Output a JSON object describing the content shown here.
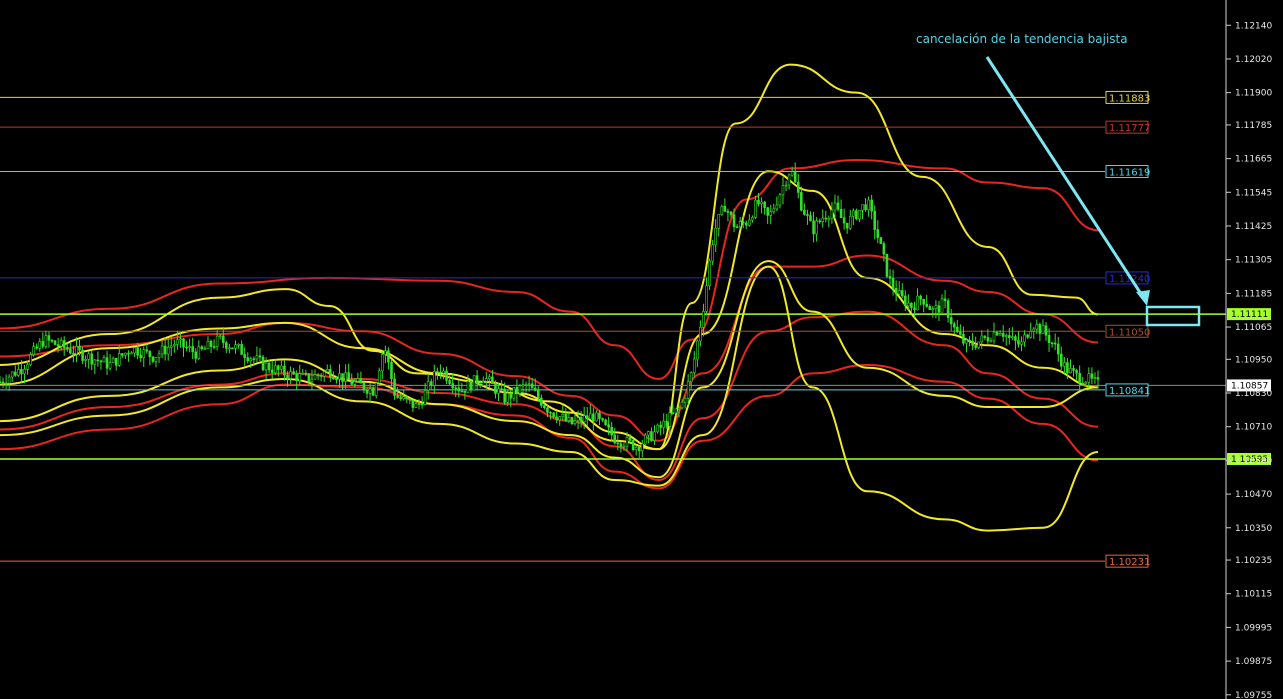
{
  "chart_data": {
    "type": "candlestick",
    "annotation": "cancelación de la tendencia bajista",
    "y_range": [
      1.0974,
      1.1223
    ],
    "y_ticks": [
      "1.12140",
      "1.12020",
      "1.11900",
      "1.11785",
      "1.11665",
      "1.11545",
      "1.11425",
      "1.11305",
      "1.11185",
      "1.11065",
      "1.10950",
      "1.10830",
      "1.10710",
      "1.10590",
      "1.10470",
      "1.10350",
      "1.10235",
      "1.10115",
      "1.09995",
      "1.09875",
      "1.09755"
    ],
    "levels": [
      {
        "value": 1.11883,
        "label": "1.11883",
        "color": "#e6d34a"
      },
      {
        "value": 1.11777,
        "label": "1.11777",
        "color": "#c0392b"
      },
      {
        "value": 1.11619,
        "label": "1.11619",
        "color": "#4fd6e6"
      },
      {
        "value": 1.1124,
        "label": "1.11240",
        "color": "#2a2ad0"
      },
      {
        "value": 1.11111,
        "label": "1.11111",
        "color": "#a6ff2e",
        "filled": true
      },
      {
        "value": 1.1105,
        "label": "1.11050",
        "color": "#a0522d"
      },
      {
        "value": 1.10841,
        "label": "1.10841",
        "color": "#4fd6e6"
      },
      {
        "value": 1.10595,
        "label": "1.10595",
        "color": "#a6ff2e",
        "filled": true
      },
      {
        "value": 1.10231,
        "label": "1.10231",
        "color": "#e0663a"
      }
    ],
    "current_price": {
      "value": 1.10857,
      "label": "1.10857"
    },
    "price_path": [
      [
        0.0,
        1.1087
      ],
      [
        0.02,
        1.1092
      ],
      [
        0.04,
        1.1102
      ],
      [
        0.06,
        1.1099
      ],
      [
        0.08,
        1.1096
      ],
      [
        0.1,
        1.1093
      ],
      [
        0.12,
        1.1099
      ],
      [
        0.14,
        1.1096
      ],
      [
        0.16,
        1.1101
      ],
      [
        0.18,
        1.1097
      ],
      [
        0.2,
        1.1102
      ],
      [
        0.22,
        1.1098
      ],
      [
        0.24,
        1.1093
      ],
      [
        0.26,
        1.109
      ],
      [
        0.28,
        1.1088
      ],
      [
        0.3,
        1.1091
      ],
      [
        0.32,
        1.1087
      ],
      [
        0.34,
        1.1084
      ],
      [
        0.35,
        1.11
      ],
      [
        0.36,
        1.1082
      ],
      [
        0.38,
        1.1078
      ],
      [
        0.4,
        1.1092
      ],
      [
        0.42,
        1.1084
      ],
      [
        0.44,
        1.1089
      ],
      [
        0.46,
        1.1081
      ],
      [
        0.48,
        1.1086
      ],
      [
        0.5,
        1.1077
      ],
      [
        0.52,
        1.1072
      ],
      [
        0.54,
        1.1075
      ],
      [
        0.56,
        1.1067
      ],
      [
        0.58,
        1.1064
      ],
      [
        0.6,
        1.107
      ],
      [
        0.62,
        1.1078
      ],
      [
        0.63,
        1.109
      ],
      [
        0.64,
        1.1112
      ],
      [
        0.65,
        1.114
      ],
      [
        0.66,
        1.115
      ],
      [
        0.67,
        1.1142
      ],
      [
        0.68,
        1.1144
      ],
      [
        0.69,
        1.1151
      ],
      [
        0.7,
        1.1145
      ],
      [
        0.71,
        1.1154
      ],
      [
        0.72,
        1.1163
      ],
      [
        0.73,
        1.115
      ],
      [
        0.74,
        1.1141
      ],
      [
        0.75,
        1.1146
      ],
      [
        0.76,
        1.1149
      ],
      [
        0.77,
        1.1143
      ],
      [
        0.78,
        1.1147
      ],
      [
        0.79,
        1.1151
      ],
      [
        0.8,
        1.1138
      ],
      [
        0.81,
        1.1123
      ],
      [
        0.82,
        1.1117
      ],
      [
        0.83,
        1.1114
      ],
      [
        0.84,
        1.1117
      ],
      [
        0.85,
        1.1112
      ],
      [
        0.86,
        1.1115
      ],
      [
        0.87,
        1.1105
      ],
      [
        0.88,
        1.11
      ],
      [
        0.89,
        1.1101
      ],
      [
        0.9,
        1.1103
      ],
      [
        0.91,
        1.1106
      ],
      [
        0.92,
        1.1102
      ],
      [
        0.93,
        1.11
      ],
      [
        0.94,
        1.1108
      ],
      [
        0.95,
        1.1105
      ],
      [
        0.96,
        1.11
      ],
      [
        0.97,
        1.1092
      ],
      [
        0.98,
        1.1089
      ],
      [
        0.99,
        1.1088
      ],
      [
        1.0,
        1.1086
      ]
    ],
    "bands": [
      {
        "name": "outer-red-upper",
        "color": "#e8251f",
        "points": [
          [
            0,
            1.1106
          ],
          [
            0.1,
            1.1113
          ],
          [
            0.2,
            1.1122
          ],
          [
            0.3,
            1.1124
          ],
          [
            0.4,
            1.1123
          ],
          [
            0.47,
            1.1119
          ],
          [
            0.52,
            1.1112
          ],
          [
            0.56,
            1.11
          ],
          [
            0.6,
            1.1088
          ],
          [
            0.63,
            1.1102
          ],
          [
            0.68,
            1.1152
          ],
          [
            0.72,
            1.1163
          ],
          [
            0.78,
            1.1166
          ],
          [
            0.86,
            1.1163
          ],
          [
            0.9,
            1.1158
          ],
          [
            0.95,
            1.1156
          ],
          [
            1.0,
            1.1141
          ]
        ]
      },
      {
        "name": "outer-red-lower",
        "color": "#e8251f",
        "points": [
          [
            0,
            1.1063
          ],
          [
            0.1,
            1.107
          ],
          [
            0.2,
            1.1079
          ],
          [
            0.26,
            1.1086
          ],
          [
            0.33,
            1.1085
          ],
          [
            0.4,
            1.1079
          ],
          [
            0.47,
            1.1075
          ],
          [
            0.52,
            1.1067
          ],
          [
            0.56,
            1.1055
          ],
          [
            0.6,
            1.1049
          ],
          [
            0.64,
            1.1066
          ],
          [
            0.7,
            1.1082
          ],
          [
            0.74,
            1.109
          ],
          [
            0.79,
            1.1093
          ],
          [
            0.86,
            1.1087
          ],
          [
            0.9,
            1.1081
          ],
          [
            0.95,
            1.1072
          ],
          [
            1.0,
            1.1059
          ]
        ]
      },
      {
        "name": "inner-red-upper",
        "color": "#e8251f",
        "points": [
          [
            0,
            1.1096
          ],
          [
            0.1,
            1.11
          ],
          [
            0.2,
            1.1104
          ],
          [
            0.26,
            1.1108
          ],
          [
            0.33,
            1.1105
          ],
          [
            0.4,
            1.1097
          ],
          [
            0.47,
            1.1089
          ],
          [
            0.52,
            1.1082
          ],
          [
            0.56,
            1.1075
          ],
          [
            0.6,
            1.1066
          ],
          [
            0.64,
            1.109
          ],
          [
            0.7,
            1.1128
          ],
          [
            0.74,
            1.1128
          ],
          [
            0.79,
            1.1132
          ],
          [
            0.86,
            1.1123
          ],
          [
            0.9,
            1.1119
          ],
          [
            0.95,
            1.1111
          ],
          [
            1.0,
            1.1101
          ]
        ]
      },
      {
        "name": "inner-red-lower",
        "color": "#e8251f",
        "points": [
          [
            0,
            1.107
          ],
          [
            0.1,
            1.1078
          ],
          [
            0.2,
            1.1086
          ],
          [
            0.26,
            1.109
          ],
          [
            0.33,
            1.1088
          ],
          [
            0.4,
            1.1083
          ],
          [
            0.47,
            1.1079
          ],
          [
            0.52,
            1.1073
          ],
          [
            0.56,
            1.1064
          ],
          [
            0.6,
            1.1052
          ],
          [
            0.64,
            1.1074
          ],
          [
            0.7,
            1.1105
          ],
          [
            0.74,
            1.111
          ],
          [
            0.79,
            1.1112
          ],
          [
            0.86,
            1.11
          ],
          [
            0.9,
            1.109
          ],
          [
            0.95,
            1.1081
          ],
          [
            1.0,
            1.1071
          ]
        ]
      },
      {
        "name": "outer-yellow-upper",
        "color": "#f2e82a",
        "points": [
          [
            0,
            1.1093
          ],
          [
            0.1,
            1.1104
          ],
          [
            0.2,
            1.1117
          ],
          [
            0.26,
            1.112
          ],
          [
            0.3,
            1.1114
          ],
          [
            0.34,
            1.1098
          ],
          [
            0.38,
            1.109
          ],
          [
            0.44,
            1.1087
          ],
          [
            0.5,
            1.108
          ],
          [
            0.56,
            1.1066
          ],
          [
            0.6,
            1.1063
          ],
          [
            0.63,
            1.1115
          ],
          [
            0.67,
            1.1179
          ],
          [
            0.72,
            1.12
          ],
          [
            0.78,
            1.119
          ],
          [
            0.84,
            1.116
          ],
          [
            0.9,
            1.1135
          ],
          [
            0.94,
            1.1118
          ],
          [
            0.98,
            1.1117
          ],
          [
            1.0,
            1.1111
          ]
        ]
      },
      {
        "name": "outer-yellow-lower",
        "color": "#f2e82a",
        "points": [
          [
            0,
            1.1068
          ],
          [
            0.1,
            1.1075
          ],
          [
            0.2,
            1.1085
          ],
          [
            0.26,
            1.1088
          ],
          [
            0.33,
            1.108
          ],
          [
            0.4,
            1.1072
          ],
          [
            0.47,
            1.1065
          ],
          [
            0.52,
            1.1062
          ],
          [
            0.56,
            1.1052
          ],
          [
            0.6,
            1.105
          ],
          [
            0.64,
            1.1068
          ],
          [
            0.7,
            1.1128
          ],
          [
            0.74,
            1.1085
          ],
          [
            0.79,
            1.1048
          ],
          [
            0.86,
            1.1038
          ],
          [
            0.9,
            1.1034
          ],
          [
            0.95,
            1.1035
          ],
          [
            1.0,
            1.1062
          ]
        ]
      },
      {
        "name": "inner-yellow-upper",
        "color": "#f2e82a",
        "points": [
          [
            0,
            1.1086
          ],
          [
            0.1,
            1.1099
          ],
          [
            0.2,
            1.1106
          ],
          [
            0.26,
            1.1108
          ],
          [
            0.33,
            1.1099
          ],
          [
            0.4,
            1.109
          ],
          [
            0.47,
            1.1083
          ],
          [
            0.52,
            1.1076
          ],
          [
            0.56,
            1.1069
          ],
          [
            0.6,
            1.1063
          ],
          [
            0.64,
            1.1104
          ],
          [
            0.7,
            1.1162
          ],
          [
            0.74,
            1.1155
          ],
          [
            0.79,
            1.1124
          ],
          [
            0.86,
            1.1104
          ],
          [
            0.9,
            1.11
          ],
          [
            0.95,
            1.1092
          ],
          [
            1.0,
            1.1085
          ]
        ]
      },
      {
        "name": "inner-yellow-lower",
        "color": "#f2e82a",
        "points": [
          [
            0,
            1.1073
          ],
          [
            0.1,
            1.1082
          ],
          [
            0.2,
            1.1091
          ],
          [
            0.26,
            1.1095
          ],
          [
            0.33,
            1.1087
          ],
          [
            0.4,
            1.1079
          ],
          [
            0.47,
            1.1073
          ],
          [
            0.52,
            1.1068
          ],
          [
            0.56,
            1.106
          ],
          [
            0.6,
            1.1053
          ],
          [
            0.64,
            1.1085
          ],
          [
            0.7,
            1.113
          ],
          [
            0.74,
            1.1112
          ],
          [
            0.79,
            1.1092
          ],
          [
            0.86,
            1.1082
          ],
          [
            0.9,
            1.1078
          ],
          [
            0.95,
            1.1078
          ],
          [
            1.0,
            1.1085
          ]
        ]
      }
    ]
  }
}
